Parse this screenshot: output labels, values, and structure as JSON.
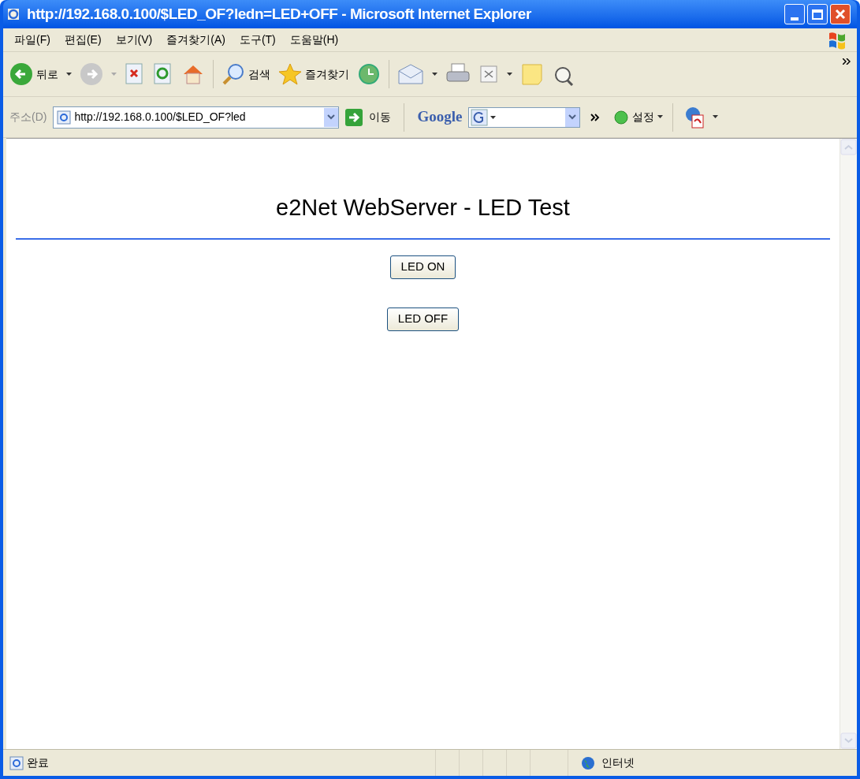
{
  "window": {
    "title": "http://192.168.0.100/$LED_OF?ledn=LED+OFF - Microsoft Internet Explorer"
  },
  "menu": [
    "파일(F)",
    "편집(E)",
    "보기(V)",
    "즐겨찾기(A)",
    "도구(T)",
    "도움말(H)"
  ],
  "toolbar": {
    "back_label": "뒤로",
    "search_label": "검색",
    "favorites_label": "즐겨찾기"
  },
  "address_bar": {
    "label": "주소(D)",
    "value": "http://192.168.0.100/$LED_OF?led",
    "go_label": "이동",
    "google_label": "Google",
    "settings_label": "설정"
  },
  "page": {
    "heading": "e2Net WebServer - LED Test",
    "buttons": [
      "LED ON",
      "LED OFF"
    ]
  },
  "status_bar": {
    "text": "완료",
    "zone": "인터넷"
  }
}
